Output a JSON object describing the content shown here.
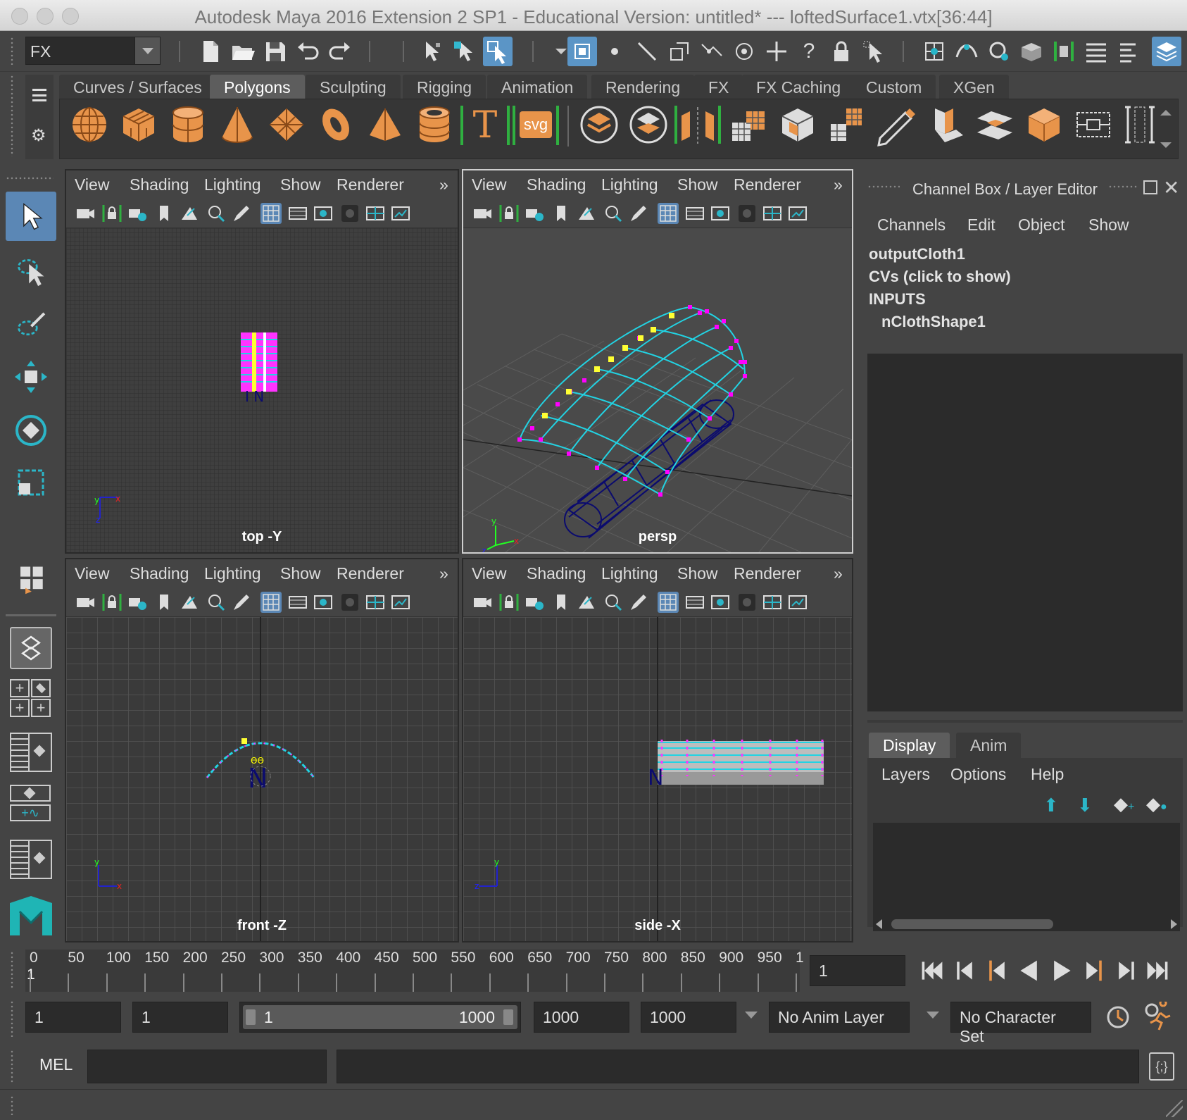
{
  "window": {
    "title": "Autodesk Maya 2016 Extension 2 SP1 - Educational Version: untitled*   ---   loftedSurface1.vtx[36:44]"
  },
  "status_line": {
    "menu_set": "FX"
  },
  "shelf": {
    "tabs": [
      "Curves / Surfaces",
      "Polygons",
      "Sculpting",
      "Rigging",
      "Animation",
      "Rendering",
      "FX",
      "FX Caching",
      "Custom",
      "XGen"
    ],
    "active_tab": "Polygons",
    "text_icon_label": "T",
    "svg_icon_label": "svg"
  },
  "viewports": {
    "menu": [
      "View",
      "Shading",
      "Lighting",
      "Show",
      "Renderer"
    ],
    "top": {
      "label": "top -Y"
    },
    "persp": {
      "label": "persp"
    },
    "front": {
      "label": "front -Z"
    },
    "side": {
      "label": "side -X"
    }
  },
  "channel_box": {
    "title": "Channel Box / Layer Editor",
    "menu": [
      "Channels",
      "Edit",
      "Object",
      "Show"
    ],
    "object": "outputCloth1",
    "cvs": "CVs (click to show)",
    "inputs_header": "INPUTS",
    "input_node": "nClothShape1"
  },
  "layer_editor": {
    "tabs": [
      "Display",
      "Anim"
    ],
    "active_tab": "Display",
    "menu": [
      "Layers",
      "Options",
      "Help"
    ]
  },
  "time_slider": {
    "ticks": [
      "0",
      "50",
      "100",
      "150",
      "200",
      "250",
      "300",
      "350",
      "400",
      "450",
      "500",
      "550",
      "600",
      "650",
      "700",
      "750",
      "800",
      "850",
      "900",
      "950",
      "1"
    ],
    "current_frame_marker": "1",
    "current_time": "1"
  },
  "range_slider": {
    "start_time": "1",
    "playback_start": "1",
    "range_start": "1",
    "range_end": "1000",
    "playback_end": "1000",
    "end_time": "1000",
    "anim_layer": "No Anim Layer",
    "character_set": "No Character Set"
  },
  "command_line": {
    "language": "MEL"
  },
  "colors": {
    "accent": "#5b95c6",
    "shelf_orange": "#e8944a",
    "cv_magenta": "#ff00ff",
    "wire_cyan": "#22d3e3",
    "mesh_navy": "#0b0b6e"
  }
}
